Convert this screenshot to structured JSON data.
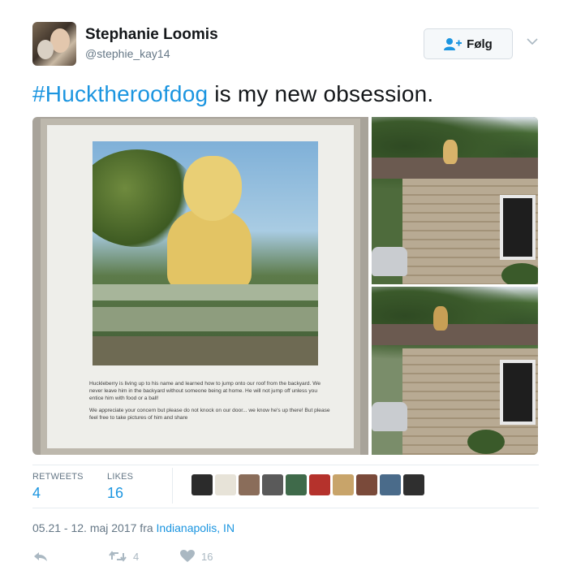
{
  "user": {
    "name": "Stephanie Loomis",
    "handle": "@stephie_kay14"
  },
  "follow_button": {
    "label": "Følg",
    "icon": "add-user-icon"
  },
  "tweet": {
    "hashtag": "#Hucktheroofdog",
    "text": " is my new obsession."
  },
  "poster": {
    "paragraph1": "Huckleberry is living up to his name and learned how to jump onto our roof from the backyard. We never leave him in the backyard without someone being at home. He will not jump off unless you entice him with food or a ball!",
    "paragraph2": "We appreciate your concern but please do not knock on our door... we know he's up there! But please feel free to take pictures of him and share"
  },
  "stats": {
    "retweets_label": "RETWEETS",
    "retweets_value": "4",
    "likes_label": "LIKES",
    "likes_value": "16"
  },
  "likers": {
    "count": 10,
    "colors": [
      "#2b2b2b",
      "#e7e3d8",
      "#8a6d5a",
      "#5a5a5a",
      "#3f6a4a",
      "#b5322c",
      "#c8a46a",
      "#7a4a3a",
      "#4a6b8a",
      "#2f2f2f"
    ]
  },
  "meta": {
    "timestamp": "05.21 - 12. maj 2017 fra ",
    "location": "Indianapolis, IN"
  },
  "actions": {
    "retweet_count": "4",
    "like_count": "16"
  },
  "colors": {
    "accent": "#1b95e0",
    "secondary_text": "#657786",
    "icon_gray": "#aab8c2"
  }
}
